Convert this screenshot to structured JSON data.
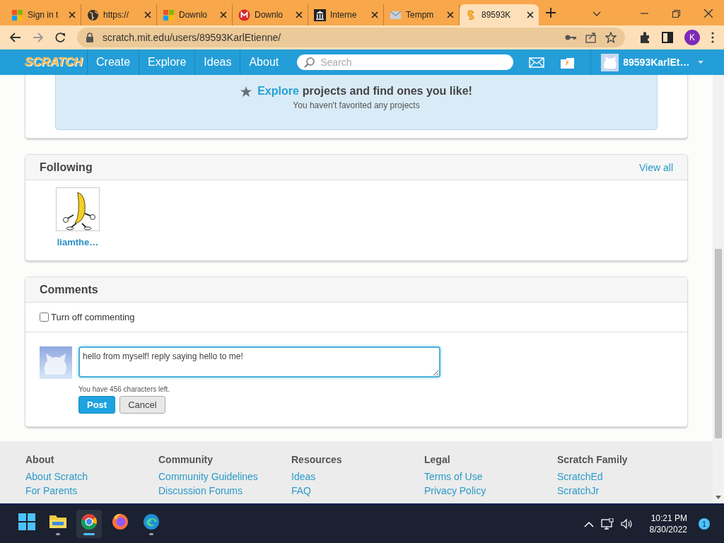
{
  "browser": {
    "tabs": [
      {
        "title": "Sign in t",
        "kind": "windows",
        "selected": false
      },
      {
        "title": "https://",
        "kind": "globe",
        "selected": false
      },
      {
        "title": "Downlo",
        "kind": "windows",
        "selected": false
      },
      {
        "title": "Downlo",
        "kind": "mega",
        "selected": false
      },
      {
        "title": "Interne",
        "kind": "bank",
        "selected": false
      },
      {
        "title": "Tempm",
        "kind": "mail",
        "selected": false
      },
      {
        "title": "89593K",
        "kind": "scratch",
        "selected": true
      }
    ],
    "address": "scratch.mit.edu/users/89593KarlEtienne/",
    "profile_initial": "K"
  },
  "nav": {
    "logo": "SCRATCH",
    "items": [
      "Create",
      "Explore",
      "Ideas",
      "About"
    ],
    "search_placeholder": "Search",
    "username": "89593KarlEt…"
  },
  "favorites": {
    "link": "Explore",
    "text": "projects and find ones you like!",
    "note": "You haven't favorited any projects"
  },
  "following": {
    "title": "Following",
    "view_all": "View all",
    "users": [
      {
        "name": "liamthe…"
      }
    ]
  },
  "comments": {
    "title": "Comments",
    "turn_off": {
      "label": "Turn off commenting",
      "checked": false
    },
    "draft": "hello from myself! reply saying hello to me!",
    "chars_left": "You have 456 characters left.",
    "buttons": [
      {
        "label": "Post",
        "kind": "primary"
      },
      {
        "label": "Cancel",
        "kind": "secondary"
      }
    ]
  },
  "footer": [
    {
      "heading": "About",
      "links": [
        "About Scratch",
        "For Parents"
      ]
    },
    {
      "heading": "Community",
      "links": [
        "Community Guidelines",
        "Discussion Forums"
      ]
    },
    {
      "heading": "Resources",
      "links": [
        "Ideas",
        "FAQ"
      ]
    },
    {
      "heading": "Legal",
      "links": [
        "Terms of Use",
        "Privacy Policy"
      ]
    },
    {
      "heading": "Scratch Family",
      "links": [
        "ScratchEd",
        "ScratchJr"
      ]
    }
  ],
  "taskbar": {
    "apps": [
      {
        "kind": "start",
        "running": false,
        "selected": false
      },
      {
        "kind": "files",
        "running": true,
        "selected": false
      },
      {
        "kind": "chrome",
        "running": true,
        "selected": true
      },
      {
        "kind": "firefox",
        "running": false,
        "selected": false
      },
      {
        "kind": "edge",
        "running": true,
        "selected": false
      }
    ],
    "time": "10:21 PM",
    "date": "8/30/2022",
    "notifications": "1"
  }
}
